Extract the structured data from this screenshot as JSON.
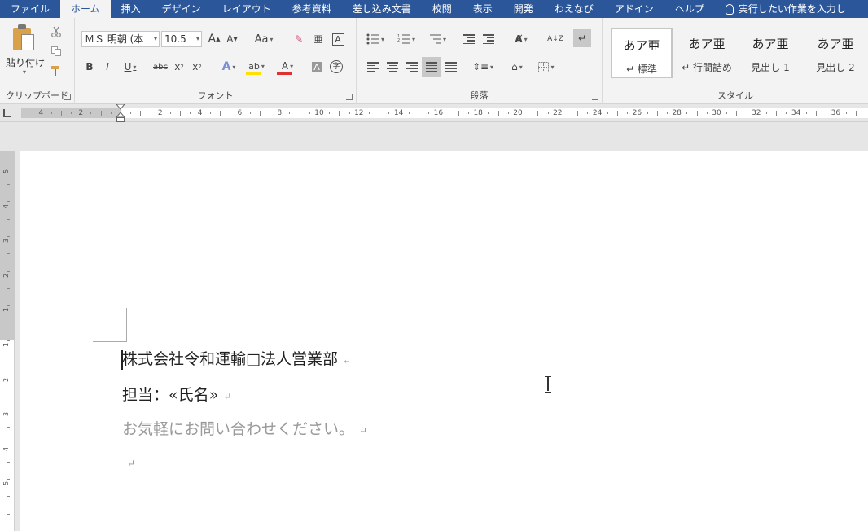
{
  "tabs": [
    {
      "label": "ファイル",
      "active": false
    },
    {
      "label": "ホーム",
      "active": true
    },
    {
      "label": "挿入",
      "active": false
    },
    {
      "label": "デザイン",
      "active": false
    },
    {
      "label": "レイアウト",
      "active": false
    },
    {
      "label": "参考資料",
      "active": false
    },
    {
      "label": "差し込み文書",
      "active": false
    },
    {
      "label": "校閲",
      "active": false
    },
    {
      "label": "表示",
      "active": false
    },
    {
      "label": "開発",
      "active": false
    },
    {
      "label": "わえなび",
      "active": false
    },
    {
      "label": "アドイン",
      "active": false
    },
    {
      "label": "ヘルプ",
      "active": false
    }
  ],
  "tell_me": {
    "placeholder": "実行したい作業を入力し",
    "icon": "lightbulb-icon"
  },
  "clipboard": {
    "paste_label": "貼り付け",
    "group_label": "クリップボード"
  },
  "font": {
    "font_name": "ＭＳ 明朝 (本",
    "font_size": "10.5",
    "grow": "A",
    "shrink": "A",
    "case": "Aa",
    "clear_char": "亜",
    "border_char": "A",
    "bold": "B",
    "italic": "I",
    "underline": "U",
    "strike": "abc",
    "sub": "x",
    "sup": "x",
    "effects": "A",
    "highlight": "ab",
    "color": "A",
    "shading": "A",
    "enclose": "字",
    "group_label": "フォント"
  },
  "paragraph": {
    "group_label": "段落",
    "sort": "A↓Z"
  },
  "styles": {
    "items": [
      {
        "preview": "あア亜",
        "name": "↵ 標準",
        "selected": true
      },
      {
        "preview": "あア亜",
        "name": "↵ 行間詰め",
        "selected": false
      },
      {
        "preview": "あア亜",
        "name": "見出し 1",
        "selected": false
      },
      {
        "preview": "あア亜",
        "name": "見出し 2",
        "selected": false
      }
    ],
    "group_label": "スタイル"
  },
  "ruler": {
    "left_numbers": [
      "4",
      "2"
    ],
    "numbers": [
      "2",
      "4",
      "6",
      "8",
      "10",
      "12",
      "14",
      "16",
      "18",
      "20",
      "22",
      "24",
      "26",
      "28",
      "30",
      "32",
      "34",
      "36"
    ],
    "v_numbers": [
      "5",
      "4",
      "3",
      "2",
      "1",
      "1",
      "2",
      "3",
      "4",
      "5"
    ]
  },
  "document": {
    "lines": [
      {
        "text": "株式会社令和運輸□法人営業部",
        "mark": "↵"
      },
      {
        "text": "担当：«氏名»",
        "mark": "↵"
      },
      {
        "text": "お気軽にお問い合わせください。",
        "mark": "↵",
        "gray": true
      },
      {
        "text": "",
        "mark": "↵"
      }
    ]
  },
  "colors": {
    "tabbar": "#2b579a",
    "highlight": "#ffe000",
    "font_color": "#e03030"
  }
}
